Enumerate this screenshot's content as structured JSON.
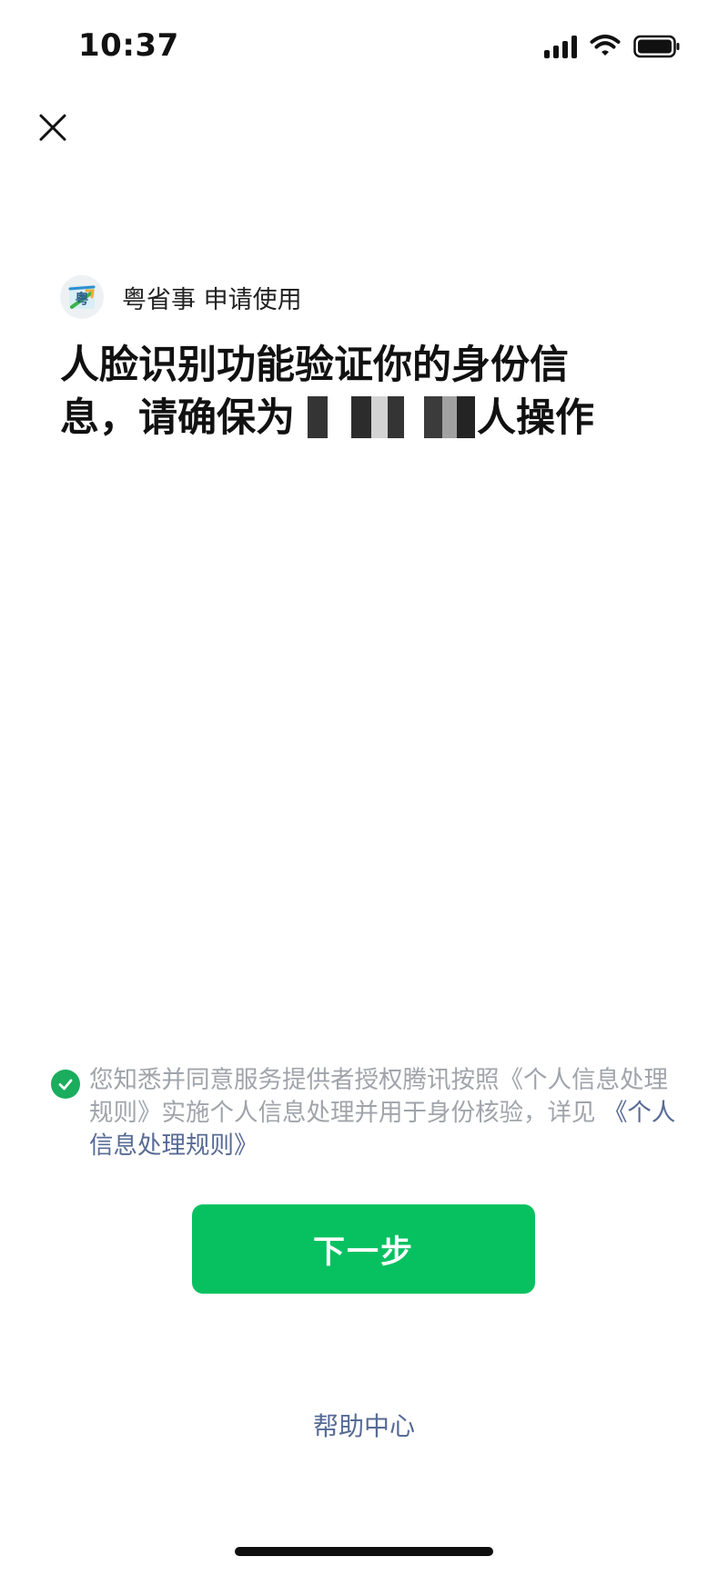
{
  "status_bar": {
    "time": "10:37",
    "icons": [
      "cellular-signal-icon",
      "wifi-icon",
      "battery-icon"
    ]
  },
  "nav": {
    "close_icon": "close-icon"
  },
  "app": {
    "name_text": "粤省事 申请使用",
    "logo_glyph": "粤"
  },
  "main": {
    "title_part1": "人脸识别功能验证你的身份信息，请确保为",
    "title_part2": "人操作"
  },
  "consent": {
    "checked": true,
    "text_prefix": "您知悉并同意服务提供者授权腾讯按照《个人信息处理规则》实施个人信息处理并用于身份核验，详见 ",
    "link_text": "《个人信息处理规则》"
  },
  "actions": {
    "next_label": "下一步",
    "help_label": "帮助中心"
  },
  "colors": {
    "primary_green": "#07c160",
    "check_green": "#1aad5d",
    "link_blue": "#576b95",
    "muted_text": "#a0a4ab"
  }
}
